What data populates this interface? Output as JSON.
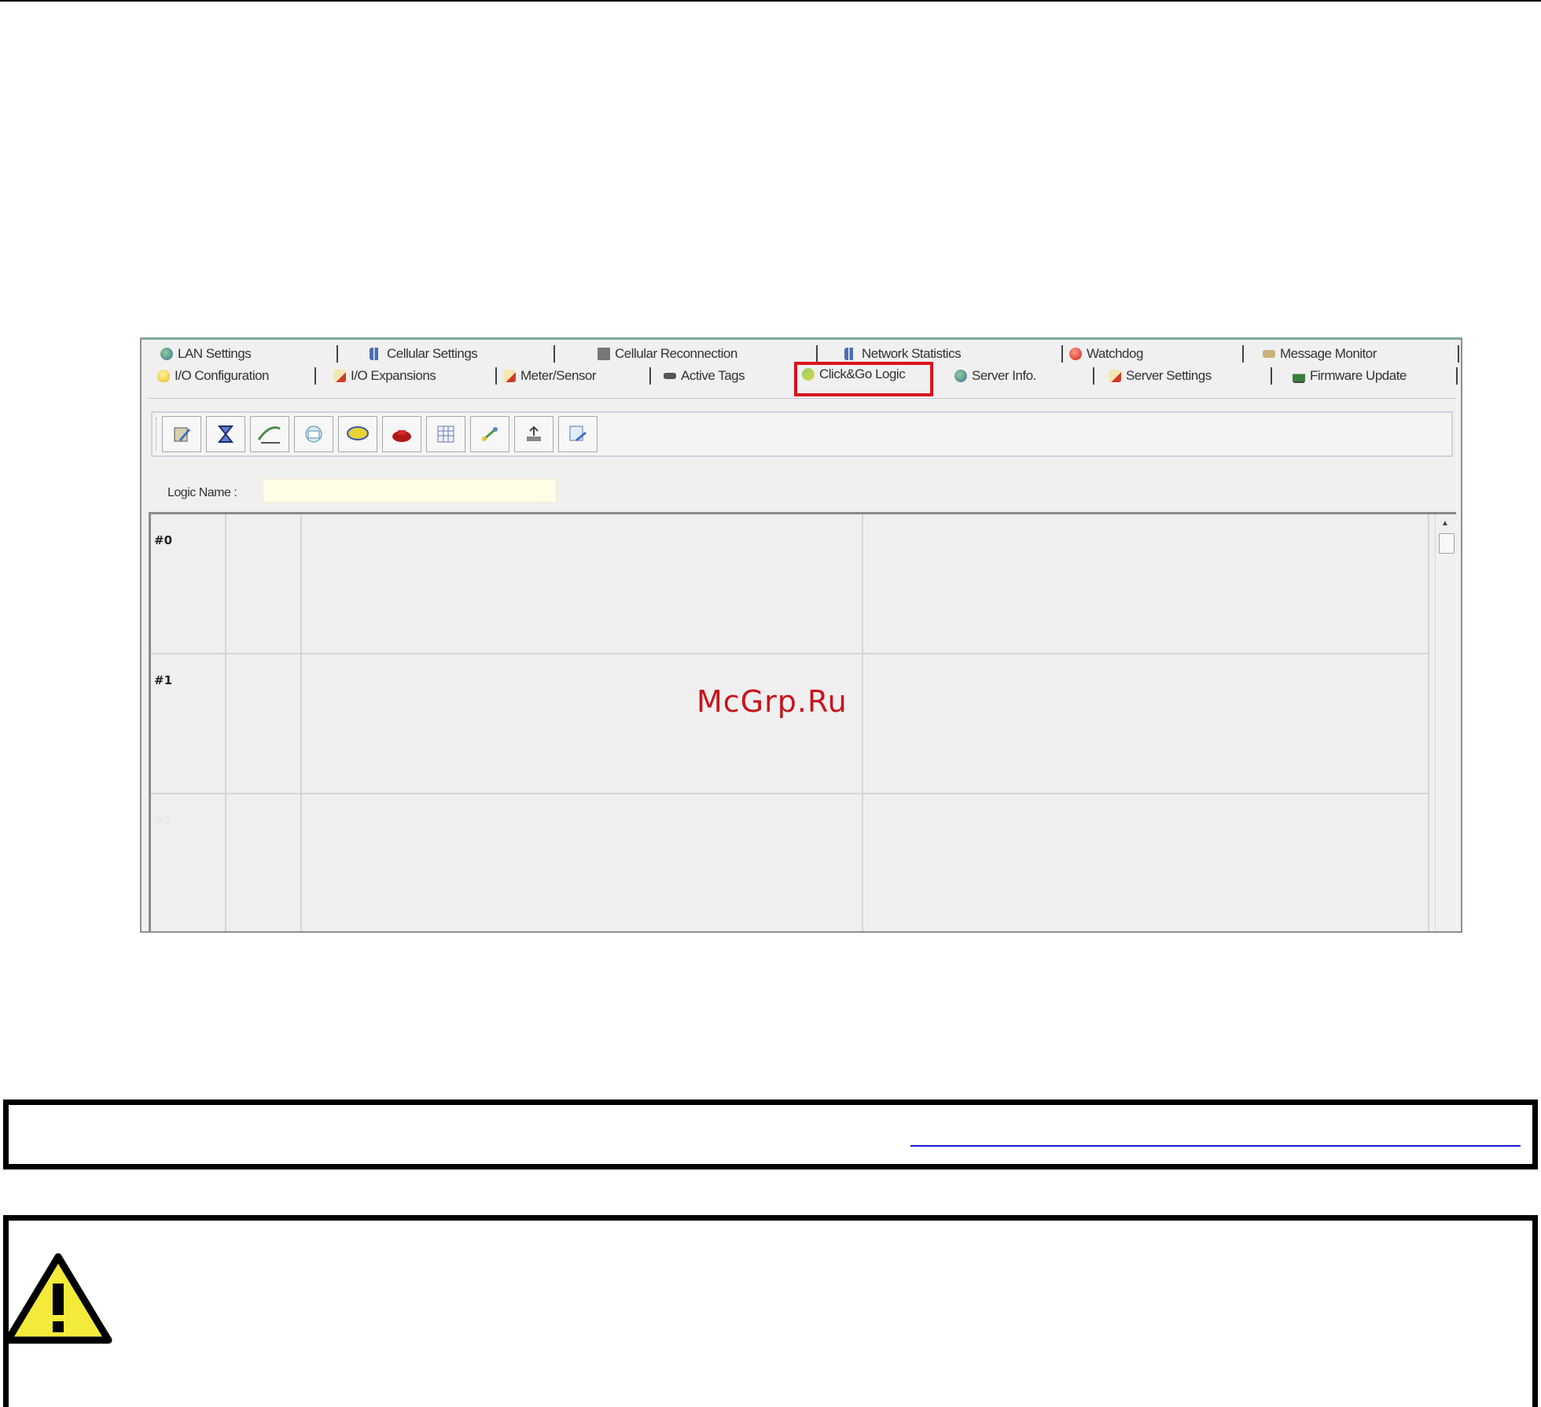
{
  "tabs": {
    "row1": [
      {
        "label": "LAN Settings",
        "icon": "globe-icon"
      },
      {
        "label": "Cellular Settings",
        "icon": "bars-icon"
      },
      {
        "label": "Cellular Reconnection",
        "icon": "antenna-icon"
      },
      {
        "label": "Network Statistics",
        "icon": "bars-icon"
      },
      {
        "label": "Watchdog",
        "icon": "alarm-icon"
      },
      {
        "label": "Message Monitor",
        "icon": "envelope-icon"
      }
    ],
    "row2": [
      {
        "label": "I/O Configuration",
        "icon": "bulb-icon"
      },
      {
        "label": "I/O Expansions",
        "icon": "note-icon"
      },
      {
        "label": "Meter/Sensor",
        "icon": "note-icon"
      },
      {
        "label": "Active Tags",
        "icon": "tag-icon"
      },
      {
        "label": "Click&Go Logic",
        "icon": "logic-icon",
        "selected": true
      },
      {
        "label": "Server Info.",
        "icon": "globe-icon"
      },
      {
        "label": "Server Settings",
        "icon": "note-icon"
      },
      {
        "label": "Firmware Update",
        "icon": "chart-icon"
      }
    ]
  },
  "toolbar": {
    "buttons": [
      "edit-icon",
      "hourglass-icon",
      "pulse-icon",
      "email-icon",
      "sms-icon",
      "phone-icon",
      "table-icon",
      "link-icon",
      "upload-icon",
      "copy-icon"
    ]
  },
  "logic": {
    "label": "Logic Name :",
    "value": ""
  },
  "rows": [
    {
      "label": "#0"
    },
    {
      "label": "#1"
    },
    {
      "label": "#2"
    }
  ],
  "watermark": "McGrp.Ru",
  "colors": {
    "highlight": "#d8141c",
    "input_bg": "#fffde6",
    "warning_yellow": "#f4ea3a",
    "link": "#1a1ad0"
  }
}
